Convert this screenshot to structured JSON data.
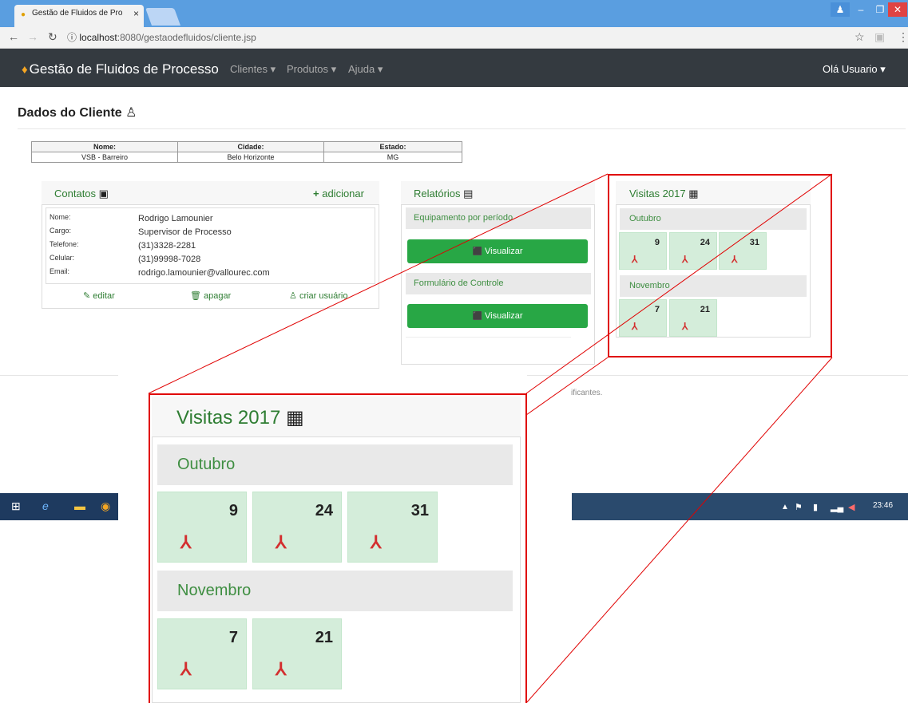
{
  "browser": {
    "tab_title": "Gestão de Fluidos de Pro",
    "tab_close": "×",
    "url_host": "localhost",
    "url_path": ":8080/gestaodefluidos/cliente.jsp",
    "info_glyph": "ⓘ"
  },
  "app": {
    "brand": "Gestão de Fluidos de Processo",
    "nav": [
      "Clientes ▾",
      "Produtos ▾",
      "Ajuda ▾"
    ],
    "user": "Olá Usuario ▾"
  },
  "page": {
    "title": "Dados do Cliente",
    "client": {
      "headers": [
        "Nome:",
        "Cidade:",
        "Estado:"
      ],
      "values": [
        "VSB - Barreiro",
        "Belo Horizonte",
        "MG"
      ]
    }
  },
  "contatos": {
    "title": "Contatos",
    "add": "adicionar",
    "fields": [
      {
        "label": "Nome:",
        "value": "Rodrigo Lamounier"
      },
      {
        "label": "Cargo:",
        "value": "Supervisor de Processo"
      },
      {
        "label": "Telefone:",
        "value": "(31)3328-2281"
      },
      {
        "label": "Celular:",
        "value": "(31)99998-7028"
      },
      {
        "label": "Email:",
        "value": "rodrigo.lamounier@vallourec.com"
      }
    ],
    "actions": [
      "editar",
      "apagar",
      "criar usuário"
    ]
  },
  "relatorios": {
    "title": "Relatórios",
    "items": [
      {
        "label": "Equipamento por período",
        "button": "Visualizar"
      },
      {
        "label": "Formulário de Controle",
        "button": "Visualizar"
      }
    ]
  },
  "visitas": {
    "title": "Visitas 2017",
    "months": [
      {
        "name": "Outubro",
        "days": [
          "9",
          "24",
          "31"
        ]
      },
      {
        "name": "Novembro",
        "days": [
          "7",
          "21"
        ]
      }
    ]
  },
  "footer": {
    "text": "ificantes."
  },
  "taskbar": {
    "clock": "23:46"
  },
  "colors": {
    "navbar": "#343a40",
    "button_green": "#28a745",
    "day_green": "#d4edda",
    "highlight_red": "#e00000"
  }
}
